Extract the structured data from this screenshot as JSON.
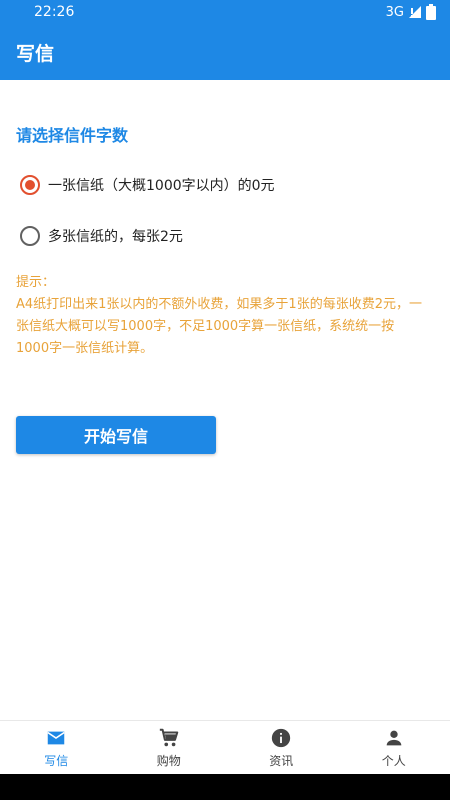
{
  "status_bar": {
    "time": "22:26",
    "network": "3G"
  },
  "header": {
    "title": "写信"
  },
  "main": {
    "section_title": "请选择信件字数",
    "options": [
      {
        "label": "一张信纸（大概1000字以内）的0元",
        "checked": true
      },
      {
        "label": "多张信纸的，每张2元",
        "checked": false
      }
    ],
    "hint_title": "提示：",
    "hint_body": "A4纸打印出来1张以内的不额外收费，如果多于1张的每张收费2元，一张信纸大概可以写1000字，不足1000字算一张信纸，系统统一按1000字一张信纸计算。",
    "start_button": "开始写信"
  },
  "bottom_nav": {
    "items": [
      {
        "label": "写信",
        "icon": "mail-icon",
        "active": true
      },
      {
        "label": "购物",
        "icon": "cart-icon",
        "active": false
      },
      {
        "label": "资讯",
        "icon": "info-icon",
        "active": false
      },
      {
        "label": "个人",
        "icon": "person-icon",
        "active": false
      }
    ]
  },
  "colors": {
    "primary": "#1e88e5",
    "radio_accent": "#e2502f",
    "hint": "#e8a33a"
  }
}
